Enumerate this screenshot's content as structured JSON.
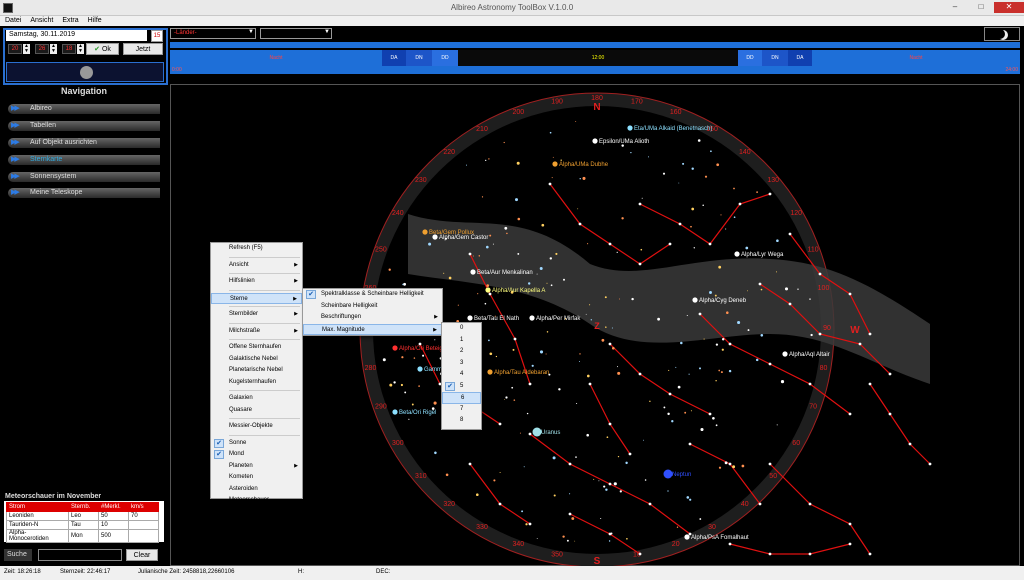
{
  "window": {
    "title": "Albireo Astronomy ToolBox V.1.0.0",
    "minimize": "–",
    "maximize": "□",
    "close": "✕"
  },
  "menu": [
    "Datei",
    "Ansicht",
    "Extra",
    "Hilfe"
  ],
  "date": {
    "value": "Samstag, 30.11.2019",
    "calendar_icon": "15",
    "hour": "20",
    "minute": "26",
    "second": "18",
    "ok": "Ok",
    "now": "Jetzt"
  },
  "nav": {
    "title": "Navigation",
    "items": [
      {
        "label": "Albireo"
      },
      {
        "label": "Tabellen"
      },
      {
        "label": "Auf Objekt ausrichten"
      },
      {
        "label": "Sternkarte",
        "active": true
      },
      {
        "label": "Sonnensystem"
      },
      {
        "label": "Meine Teleskope"
      }
    ]
  },
  "meteor": {
    "title": "Meteorschauer im November",
    "headers": [
      "Strom",
      "Sternb.",
      "#Merkl.",
      "km/s"
    ],
    "rows": [
      [
        "Leoniden",
        "Leo",
        "50",
        "70"
      ],
      [
        "Tauriden-N",
        "Tau",
        "10",
        ""
      ],
      [
        "Alpha-Monocerotiden",
        "Mon",
        "500",
        ""
      ]
    ]
  },
  "search": {
    "label": "Suche",
    "value": "",
    "clear": "Clear"
  },
  "status": {
    "zeit": "Zeit: 18:26:18",
    "sternzeit": "Sternzeit: 22:46:17",
    "jd": "Julianische Zeit: 2458818,22660106",
    "h": "H:",
    "dec": "DEC:"
  },
  "combos": {
    "lander": "-Länder-",
    "second": ""
  },
  "timeline": {
    "segments": [
      "Nacht",
      "DA",
      "DN",
      "DD",
      "12:00",
      "DD",
      "DN",
      "DA",
      "Nacht"
    ],
    "scale_left": "0:00",
    "scale_right": "24:00"
  },
  "sky": {
    "compass": {
      "n": "N",
      "s": "S",
      "w": "W",
      "z": "Z"
    },
    "az_labels": [
      "10",
      "20",
      "30",
      "40",
      "50",
      "60",
      "70",
      "80",
      "90",
      "100",
      "110",
      "120",
      "130",
      "140",
      "150",
      "160",
      "170",
      "180",
      "190",
      "200",
      "210",
      "220",
      "230",
      "240",
      "250",
      "260",
      "270",
      "280",
      "290",
      "300",
      "310",
      "320",
      "330",
      "340",
      "350"
    ],
    "stars": [
      {
        "name": "Alpha/UMa Dubhe",
        "color": "#f0a030"
      },
      {
        "name": "Epsilon/UMa Alioth",
        "color": "#ffffff"
      },
      {
        "name": "Eta/UMa Alkaid (Benetnasch)",
        "color": "#8de0ff"
      },
      {
        "name": "Beta/Gem Pollux",
        "color": "#f0a030"
      },
      {
        "name": "Alpha/Gem Castor",
        "color": "#ffffff"
      },
      {
        "name": "Beta/Aur Menkalinan",
        "color": "#ffffff"
      },
      {
        "name": "Alpha/Aur Kapella A",
        "color": "#ffff80"
      },
      {
        "name": "Alpha/Per Mirfak",
        "color": "#ffffff"
      },
      {
        "name": "Beta/Tau El Nath",
        "color": "#ffffff"
      },
      {
        "name": "Alpha/Lyr Wega",
        "color": "#ffffff"
      },
      {
        "name": "Alpha/Cyg Deneb",
        "color": "#ffffff"
      },
      {
        "name": "Alpha/Aql Altair",
        "color": "#ffffff"
      },
      {
        "name": "Alpha/Ori Beteigeuze",
        "color": "#ff3030"
      },
      {
        "name": "Gamma/Ori Bellatrix",
        "color": "#8de0ff"
      },
      {
        "name": "Beta/Ori Rigel",
        "color": "#8de0ff"
      },
      {
        "name": "Alpha/Tau Aldebaran",
        "color": "#f0a030"
      },
      {
        "name": "Alpha/PsA Fomalhaut",
        "color": "#ffffff"
      },
      {
        "name": "Uranus",
        "color": "#a0e0e8"
      },
      {
        "name": "Neptun",
        "color": "#3050ff"
      }
    ]
  },
  "context_menu": {
    "items": [
      {
        "label": "Refresh (F5)"
      },
      {
        "sep": true
      },
      {
        "label": "Ansicht",
        "sub": true
      },
      {
        "sep": true
      },
      {
        "label": "Hilfslinien",
        "sub": true
      },
      {
        "sep": true
      },
      {
        "label": "Sterne",
        "sub": true,
        "selected": true
      },
      {
        "sep": true
      },
      {
        "label": "Sternbilder",
        "sub": true
      },
      {
        "sep": true
      },
      {
        "label": "Milchstraße",
        "sub": true
      },
      {
        "sep": true
      },
      {
        "label": "Offene Sternhaufen"
      },
      {
        "label": "Galaktische Nebel"
      },
      {
        "label": "Planetarische Nebel"
      },
      {
        "label": "Kugelsternhaufen"
      },
      {
        "sep": true
      },
      {
        "label": "Galaxien"
      },
      {
        "label": "Quasare"
      },
      {
        "sep": true
      },
      {
        "label": "Messier-Objekte"
      },
      {
        "sep": true
      },
      {
        "label": "Sonne",
        "checked": true
      },
      {
        "label": "Mond",
        "checked": true
      },
      {
        "label": "Planeten",
        "sub": true
      },
      {
        "label": "Kometen"
      },
      {
        "label": "Asteroiden"
      },
      {
        "label": "Meteorschauer"
      }
    ],
    "sterne_sub": [
      {
        "label": "Spektralklasse & Scheinbare Helligkeit",
        "checked": true
      },
      {
        "label": "Scheinbare Helligkeit"
      },
      {
        "label": "Beschriftungen",
        "sub": true
      },
      {
        "label": "Max. Magnitude",
        "sub": true,
        "selected": true
      }
    ],
    "magnitudes": [
      {
        "label": "0"
      },
      {
        "label": "1"
      },
      {
        "label": "2"
      },
      {
        "label": "3"
      },
      {
        "label": "4"
      },
      {
        "label": "5",
        "checked": true
      },
      {
        "label": "6",
        "selected": true
      },
      {
        "label": "7"
      },
      {
        "label": "8"
      }
    ]
  },
  "colors": {
    "accent": "#1e6fd8",
    "axis_red": "#e02020",
    "constellation": "#e01010"
  }
}
